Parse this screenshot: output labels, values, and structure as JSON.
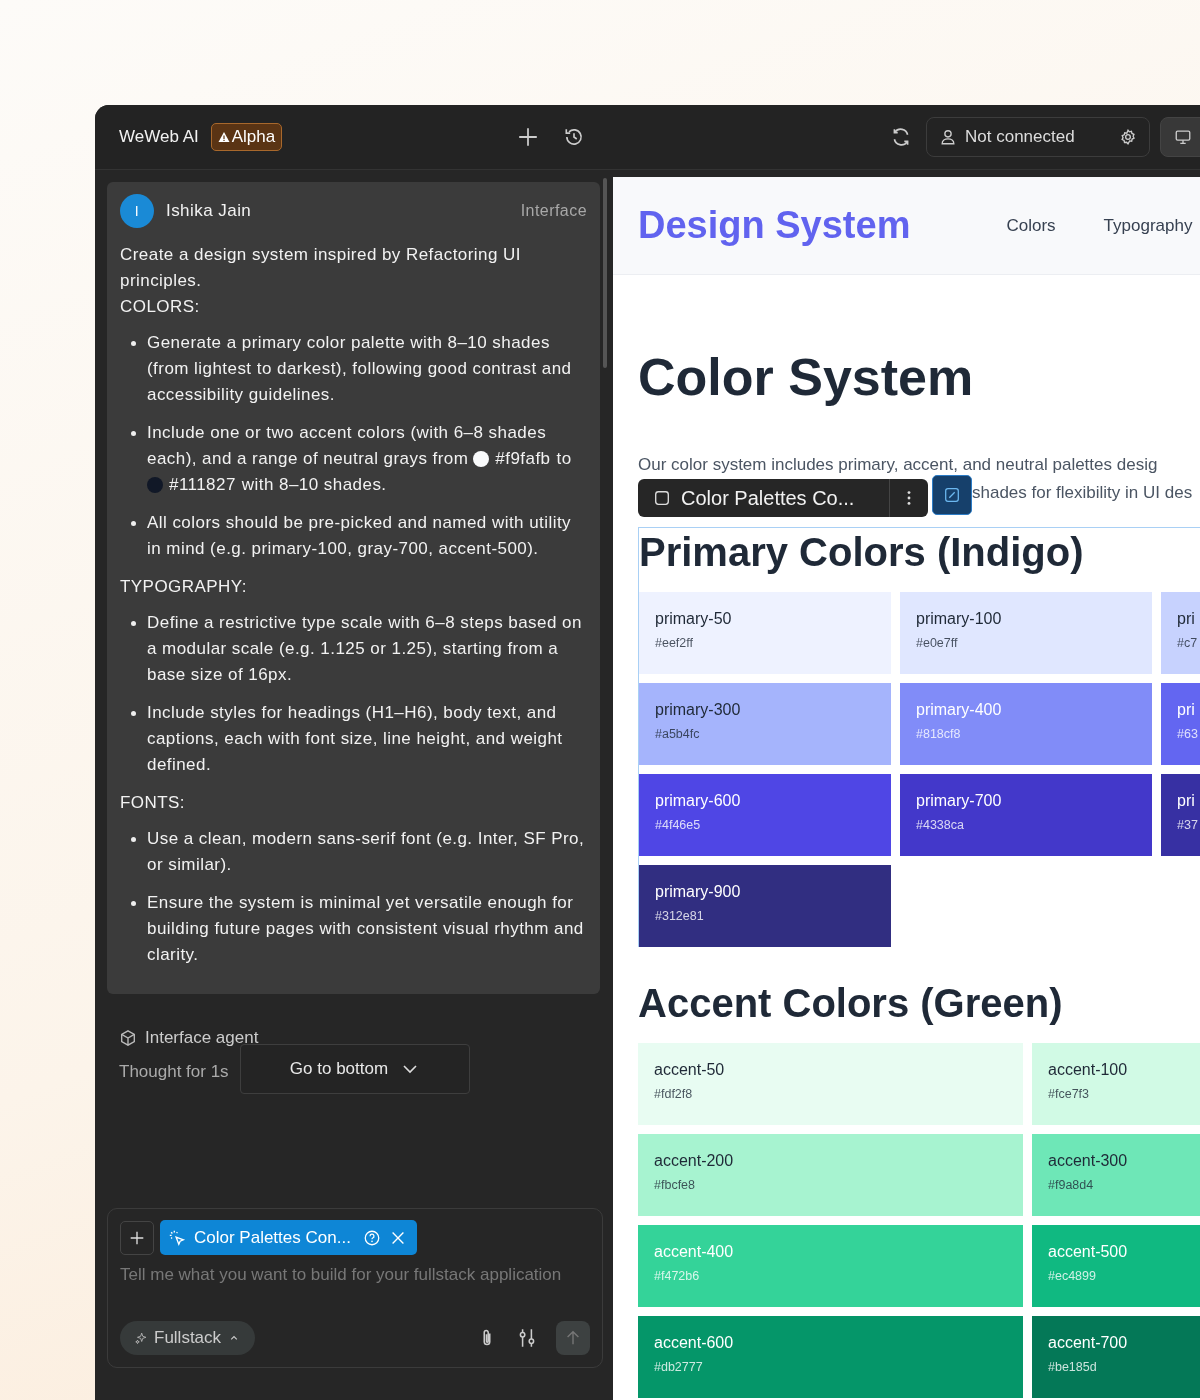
{
  "header": {
    "app_name": "WeWeb AI",
    "badge": "Alpha",
    "connection": "Not connected"
  },
  "message": {
    "avatar": "I",
    "author": "Ishika Jain",
    "tag": "Interface",
    "blocks": [
      {
        "kind": "para",
        "text": "Create a design system inspired by Refactoring UI principles."
      },
      {
        "kind": "para",
        "text": "COLORS:"
      },
      {
        "kind": "list",
        "items": [
          {
            "parts": [
              {
                "kind": "text",
                "text": "Generate a primary color palette with 8–10 shades (from lightest to darkest), following good contrast and accessibility guidelines."
              }
            ]
          },
          {
            "parts": [
              {
                "kind": "text",
                "text": "Include one or two accent colors (with 6–8 shades each), and a range of neutral grays from"
              },
              {
                "kind": "color",
                "color": "#f9fafb",
                "text": "#f9fafb"
              },
              {
                "kind": "text",
                "text": "to"
              },
              {
                "kind": "color",
                "color": "#111827",
                "text": "#111827"
              },
              {
                "kind": "text",
                "text": "with 8–10 shades."
              }
            ]
          },
          {
            "parts": [
              {
                "kind": "text",
                "text": "All colors should be pre-picked and named with utility in mind (e.g. primary-100, gray-700, accent-500)."
              }
            ]
          }
        ]
      },
      {
        "kind": "para",
        "text": "TYPOGRAPHY:"
      },
      {
        "kind": "list",
        "items": [
          {
            "parts": [
              {
                "kind": "text",
                "text": "Define a restrictive type scale with 6–8 steps based on a modular scale (e.g. 1.125 or 1.25), starting from a base size of 16px."
              }
            ]
          },
          {
            "parts": [
              {
                "kind": "text",
                "text": "Include styles for headings (H1–H6), body text, and captions, each with font size, line height, and weight defined."
              }
            ]
          }
        ]
      },
      {
        "kind": "para",
        "text": "FONTS:"
      },
      {
        "kind": "list",
        "items": [
          {
            "parts": [
              {
                "kind": "text",
                "text": "Use a clean, modern sans-serif font (e.g. Inter, SF Pro, or similar)."
              }
            ]
          },
          {
            "parts": [
              {
                "kind": "text",
                "text": "Ensure the system is minimal yet versatile enough for building future pages with consistent visual rhythm and clarity."
              }
            ]
          }
        ]
      }
    ]
  },
  "agent": {
    "label": "Interface agent",
    "thought": "Thought for 1s",
    "go_to_bottom": "Go to bottom"
  },
  "composer": {
    "chip": "Color Palettes Con...",
    "placeholder": "Tell me what you want to build for your fullstack application",
    "mode": "Fullstack"
  },
  "preview": {
    "brand": "Design System",
    "nav": [
      "Colors",
      "Typography"
    ],
    "title": "Color System",
    "intro_line_1": "Our color system includes primary, accent, and neutral palettes desig",
    "intro_line_2": "shades for flexibility in UI des",
    "toolbar_label": "Color Palettes Co...",
    "sections": [
      {
        "title": "Primary Colors (Indigo)",
        "kind": "three",
        "swatches": [
          {
            "name": "primary-50",
            "hex": "#eef2ff",
            "color": "#eef2ff"
          },
          {
            "name": "primary-100",
            "hex": "#e0e7ff",
            "color": "#e0e7ff"
          },
          {
            "name": "pri",
            "hex": "#c7",
            "color": "#c7d2fe"
          },
          {
            "name": "primary-300",
            "hex": "#a5b4fc",
            "color": "#a5b4fc"
          },
          {
            "name": "primary-400",
            "hex": "#818cf8",
            "color": "#818cf8"
          },
          {
            "name": "pri",
            "hex": "#63",
            "color": "#6366f1"
          },
          {
            "name": "primary-600",
            "hex": "#4f46e5",
            "color": "#4f46e5"
          },
          {
            "name": "primary-700",
            "hex": "#4338ca",
            "color": "#4338ca"
          },
          {
            "name": "pri",
            "hex": "#37",
            "color": "#3730a3"
          },
          {
            "name": "primary-900",
            "hex": "#312e81",
            "color": "#312e81"
          }
        ]
      },
      {
        "title": "Accent Colors (Green)",
        "kind": "two",
        "swatches": [
          {
            "name": "accent-50",
            "hex": "#fdf2f8",
            "color": "#e8fcf2"
          },
          {
            "name": "accent-100",
            "hex": "#fce7f3",
            "color": "#d1fae5"
          },
          {
            "name": "accent-200",
            "hex": "#fbcfe8",
            "color": "#a7f3d0"
          },
          {
            "name": "accent-300",
            "hex": "#f9a8d4",
            "color": "#6ee7b7"
          },
          {
            "name": "accent-400",
            "hex": "#f472b6",
            "color": "#34d399"
          },
          {
            "name": "accent-500",
            "hex": "#ec4899",
            "color": "#10b981"
          },
          {
            "name": "accent-600",
            "hex": "#db2777",
            "color": "#059669"
          },
          {
            "name": "accent-700",
            "hex": "#be185d",
            "color": "#047857"
          }
        ]
      }
    ]
  }
}
